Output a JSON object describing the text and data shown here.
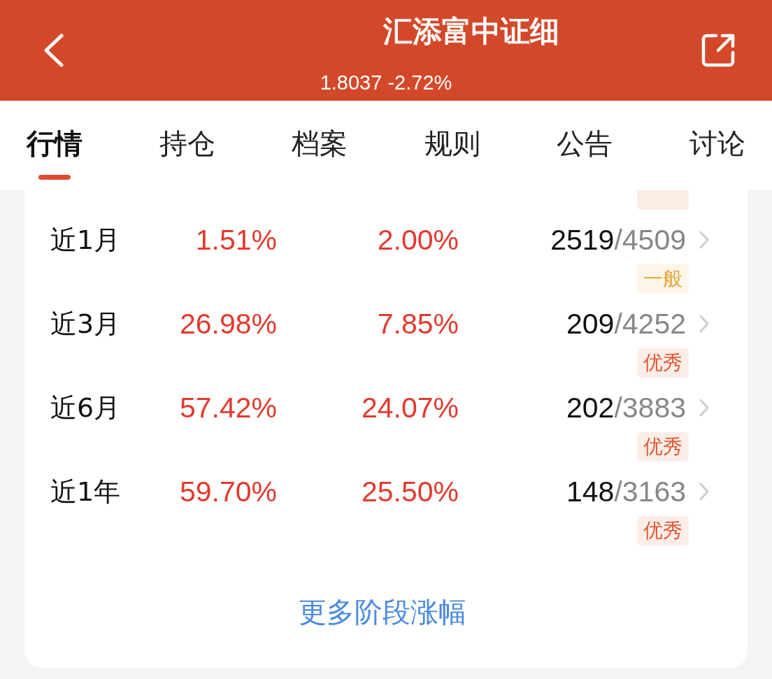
{
  "header": {
    "title": "汇添富中证细",
    "subtitle": "1.8037 -2.72%"
  },
  "tabs": [
    {
      "label": "行情",
      "selected": true
    },
    {
      "label": "持仓",
      "selected": false
    },
    {
      "label": "档案",
      "selected": false
    },
    {
      "label": "规则",
      "selected": false
    },
    {
      "label": "公告",
      "selected": false
    },
    {
      "label": "讨论",
      "selected": false
    }
  ],
  "performance": {
    "partial_tag": {
      "color": "#fcece6"
    },
    "rows": [
      {
        "column_1": "近1月",
        "column_2": "1.51%",
        "column_3": "2.00%",
        "column_4": {
          "rank": "2519",
          "total": "/4509"
        },
        "rating": {
          "text": "一般",
          "color": "#e6a535"
        }
      },
      {
        "column_1": "近3月",
        "column_2": "26.98%",
        "column_3": "7.85%",
        "column_4": {
          "rank": "209",
          "total": "/4252"
        },
        "rating": {
          "text": "优秀",
          "color": "#e0582e"
        }
      },
      {
        "column_1": "近6月",
        "column_2": "57.42%",
        "column_3": "24.07%",
        "column_4": {
          "rank": "202",
          "total": "/3883"
        },
        "rating": {
          "text": "优秀",
          "color": "#e0582e"
        }
      },
      {
        "column_1": "近1年",
        "column_2": "59.70%",
        "column_3": "25.50%",
        "column_4": {
          "rank": "148",
          "total": "/3163"
        },
        "rating": {
          "text": "优秀",
          "color": "#e0582e"
        }
      }
    ],
    "more_link": "更多阶段涨幅"
  }
}
